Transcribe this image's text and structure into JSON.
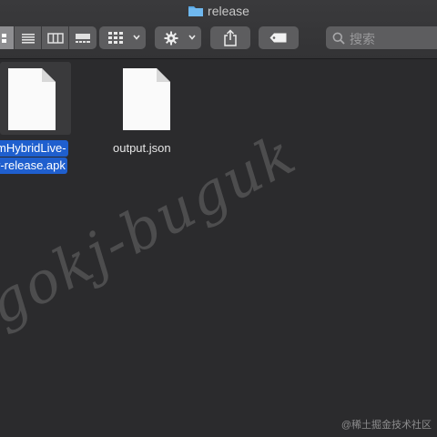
{
  "window": {
    "title": "release"
  },
  "toolbar": {
    "view_modes": [
      "icon-view",
      "list-view",
      "column-view",
      "gallery-view"
    ],
    "selected_view": "icon-view",
    "search_placeholder": "搜索"
  },
  "files": [
    {
      "name_line1": "mHybridLive-",
      "name_line2": "r-release.apk",
      "selected": true
    },
    {
      "name": "output.json",
      "selected": false
    }
  ],
  "watermark": {
    "text": "gokj-buguk",
    "credit": "@稀土掘金技术社区"
  },
  "colors": {
    "background": "#2b2b2d",
    "toolbar": "#3a3a3c",
    "selection": "#1f5fce",
    "folder": "#5aa9e6"
  }
}
